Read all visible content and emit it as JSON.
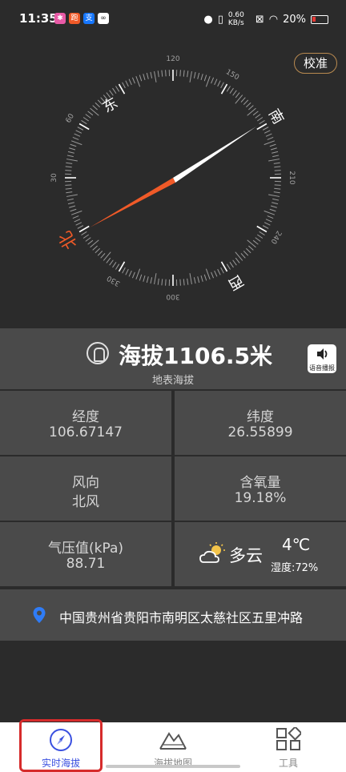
{
  "status_bar": {
    "time": "11:35",
    "network_speed": "0.60 KB/s",
    "battery": "20%",
    "icons": [
      "location-icon",
      "vibrate-icon",
      "wifi-icon",
      "battery-icon"
    ]
  },
  "compass": {
    "calibrate_label": "校准",
    "direction_labels": {
      "east": "东",
      "south": "南",
      "west": "西",
      "north": "北"
    },
    "degree_labels": [
      "120",
      "150",
      "210",
      "240",
      "300",
      "330",
      "30",
      "60"
    ],
    "needle_north_color": "#f05a28",
    "needle_south_color": "#ffffff"
  },
  "altitude": {
    "value": "海拔1106.5米",
    "subtitle": "地表海拔",
    "voice_label": "语音播报"
  },
  "info": {
    "longitude": {
      "label": "经度",
      "value": "106.67147"
    },
    "latitude": {
      "label": "纬度",
      "value": "26.55899"
    },
    "wind": {
      "label": "风向",
      "value": "北风"
    },
    "oxygen": {
      "label": "含氧量",
      "value": "19.18%"
    },
    "pressure": {
      "label": "气压值(kPa)",
      "value": "88.71"
    }
  },
  "weather": {
    "condition": "多云",
    "temperature": "4℃",
    "humidity": "湿度:72%"
  },
  "location": {
    "address": "中国贵州省贵阳市南明区太慈社区五里冲路"
  },
  "nav": {
    "items": [
      {
        "label": "实时海拔",
        "icon": "compass-icon",
        "active": true
      },
      {
        "label": "海拔地图",
        "icon": "mountain-icon",
        "active": false
      },
      {
        "label": "工具",
        "icon": "grid-icon",
        "active": false
      }
    ],
    "active_color": "#3a50e0"
  }
}
